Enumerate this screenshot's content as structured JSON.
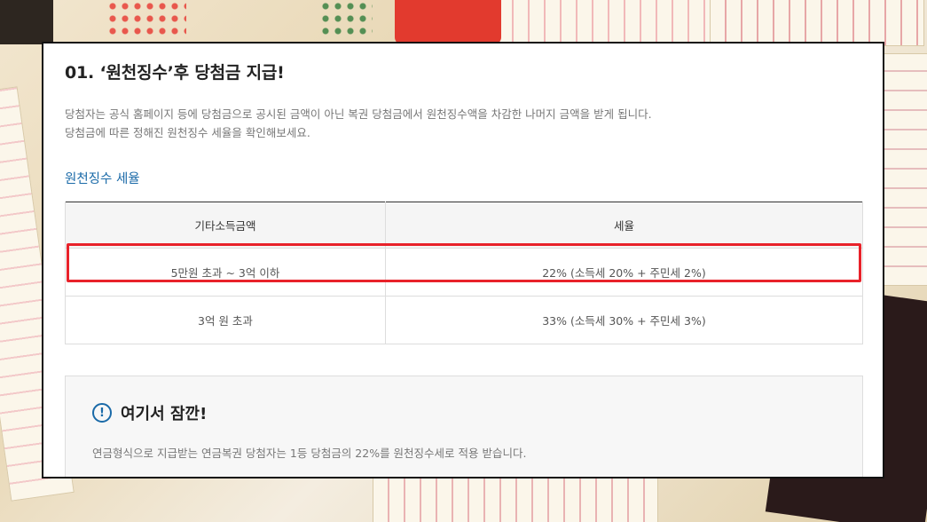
{
  "section": {
    "title": "01. ‘원천징수’후 당첨금 지급!",
    "description_lines": [
      "당첨자는 공식 홈페이지 등에 당첨금으로 공시된 금액이 아닌 복권 당첨금에서 원천징수액을 차감한 나머지 금액을 받게 됩니다.",
      "당첨금에 따른 정해진 원천징수 세율을 확인해보세요."
    ]
  },
  "tax_table": {
    "title": "원천징수 세율",
    "headers": [
      "기타소득금액",
      "세율"
    ],
    "rows": [
      {
        "range": "5만원 초과 ~ 3억 이하",
        "rate": "22% (소득세 20% + 주민세 2%)"
      },
      {
        "range": "3억 원 초과",
        "rate": "33% (소득세 30% + 주민세 3%)"
      }
    ],
    "highlight_color": "#e8222a"
  },
  "notice": {
    "icon": "exclamation-icon",
    "icon_symbol": "!",
    "title": "여기서 잠깐!",
    "text": "연금형식으로 지급받는 연금복권 당첨자는 1등 당첨금의 22%를 원천징수세로 적용 받습니다."
  },
  "colors": {
    "accent": "#1a6aa8",
    "highlight": "#e8222a"
  }
}
